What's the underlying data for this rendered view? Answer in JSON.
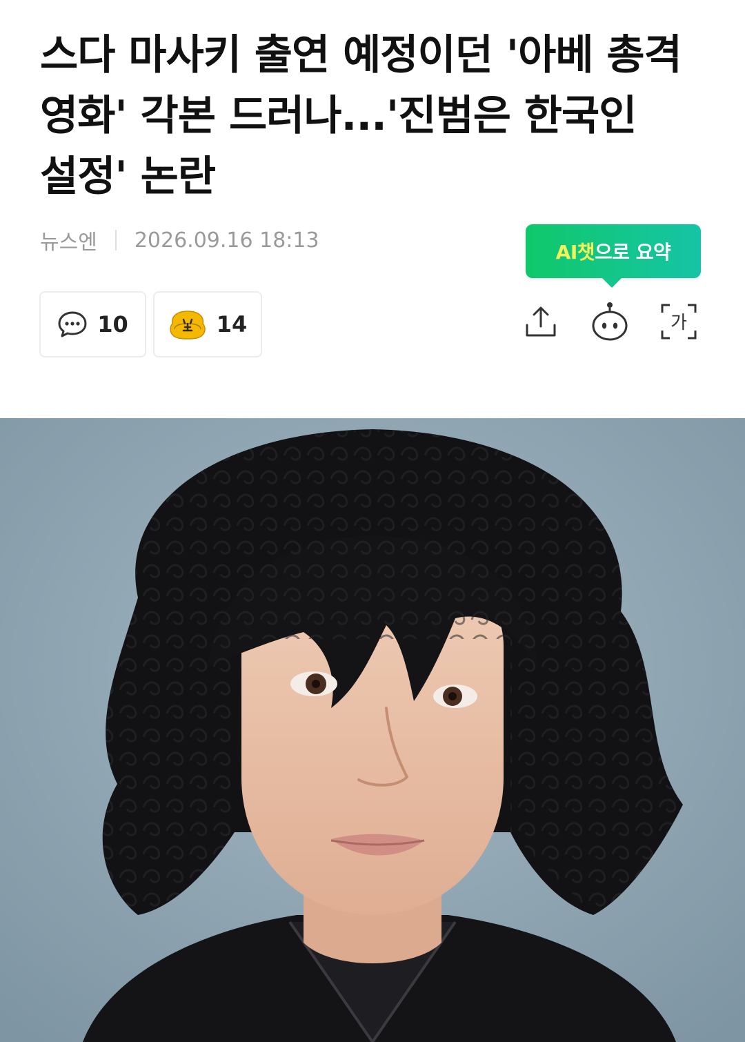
{
  "article": {
    "headline": "스다 마사키 출연 예정이던 '아베 총격 영화' 각본 드러나...'진범은 한국인 설정' 논란",
    "source": "뉴스엔",
    "datetime": "2026.09.16 18:13"
  },
  "ai_summary": {
    "label_highlight": "AI챗",
    "label_rest": "으로 요약"
  },
  "reactions": {
    "comments_count": "10",
    "emotions_count": "14"
  },
  "toolbar": {
    "share_icon": "share-icon",
    "bot_icon": "ai-bot-icon",
    "font_icon": "font-size-icon",
    "font_glyph": "가"
  },
  "colors": {
    "ai_green": "#10c86a",
    "ai_highlight": "#f2f25a",
    "meta_gray": "#9a9a9a",
    "emotion_yellow": "#f5b800"
  }
}
